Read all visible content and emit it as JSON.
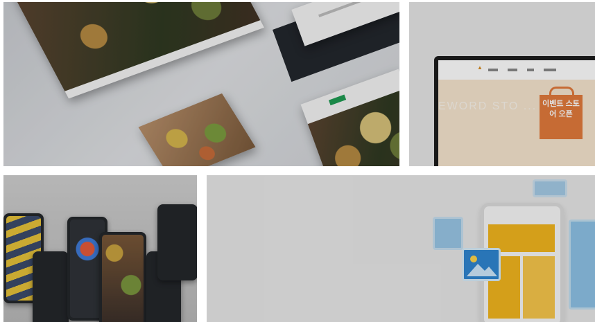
{
  "tiles": [
    {
      "id": "food-website",
      "label": ""
    },
    {
      "id": "event-store",
      "screen_nav": [
        "",
        "",
        "",
        ""
      ],
      "band_text": "EWORD STO ... NEWO",
      "bag_text": "이벤트 스토어 오픈"
    },
    {
      "id": "mobile-app",
      "label": ""
    },
    {
      "id": "illustration",
      "label": ""
    }
  ],
  "colors": {
    "accent_green": "#1f9b53",
    "orange": "#e27a3c",
    "yellow": "#f2b51e",
    "blue": "#2f86d1"
  }
}
